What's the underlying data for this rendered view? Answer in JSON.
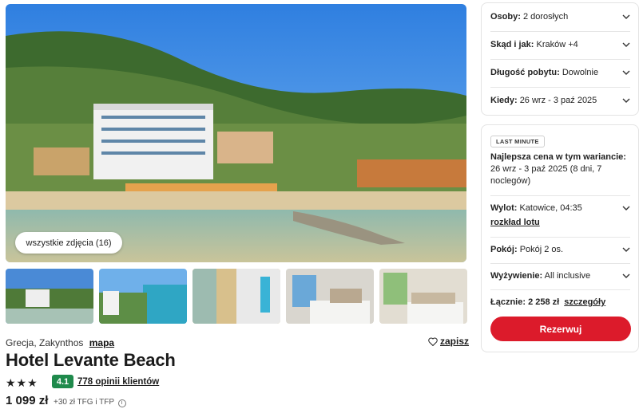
{
  "gallery": {
    "all_photos_label": "wszystkie zdjęcia (16)"
  },
  "hotel": {
    "location": "Grecja, Zakynthos",
    "map_label": "mapa",
    "save_label": "zapisz",
    "name": "Hotel Levante Beach",
    "stars": "★★★",
    "rating": "4.1",
    "reviews_label": "778 opinii klientów",
    "price": "1 099 zł",
    "price_extra": "+30 zł TFG i TFP"
  },
  "filters": [
    {
      "label": "Osoby:",
      "value": "2 dorosłych"
    },
    {
      "label": "Skąd i jak:",
      "value": "Kraków +4"
    },
    {
      "label": "Długość pobytu:",
      "value": "Dowolnie"
    },
    {
      "label": "Kiedy:",
      "value": "26 wrz - 3 paź 2025"
    }
  ],
  "offer": {
    "badge": "LAST MINUTE",
    "best_title": "Najlepsza cena w tym wariancie:",
    "best_dates": "26 wrz - 3 paź 2025 (8 dni, 7 noclegów)",
    "departure_label": "Wylot:",
    "departure_value": "Katowice, 04:35",
    "schedule_link": "rozkład lotu",
    "room_label": "Pokój:",
    "room_value": "Pokój 2 os.",
    "board_label": "Wyżywienie:",
    "board_value": "All inclusive",
    "total_label": "Łącznie: 2 258 zł",
    "details_link": "szczegóły",
    "reserve_label": "Rezerwuj"
  },
  "colors": {
    "accent": "#dc1b2b",
    "rating_bg": "#1f8a4c"
  }
}
